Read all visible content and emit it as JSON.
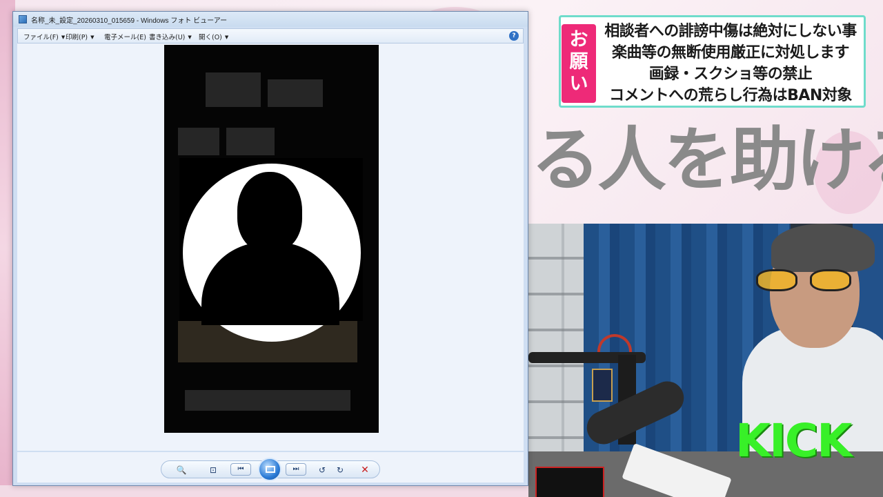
{
  "viewer": {
    "title": "名称_未_設定_20260310_015659 - Windows フォト ビューアー",
    "menu": [
      {
        "label": "ファイル(F)"
      },
      {
        "label": "印刷(P)"
      },
      {
        "label": "電子メール(E)"
      },
      {
        "label": "書き込み(U)"
      },
      {
        "label": "開く(O)"
      }
    ],
    "help_label": "?"
  },
  "notice": {
    "tag": "お願い",
    "lines": [
      "相談者への誹謗中傷は絶対にしない事",
      "楽曲等の無断使用厳正に対処します",
      "画録・スクショ等の禁止",
      "コメントへの荒らし行為はBAN対象"
    ]
  },
  "banner": {
    "text": "る人を助ける"
  },
  "overlay": {
    "kick": "KICK"
  },
  "icons": [
    "zoom-icon",
    "fit-window-icon",
    "previous-icon",
    "slideshow-icon",
    "next-icon",
    "rotate-left-icon",
    "rotate-right-icon",
    "delete-icon",
    "help-icon"
  ],
  "colors": {
    "notice_border": "#6fdccb",
    "notice_tag": "#ee2a78",
    "kick_green": "#38f028",
    "delete_red": "#c81d1d"
  }
}
